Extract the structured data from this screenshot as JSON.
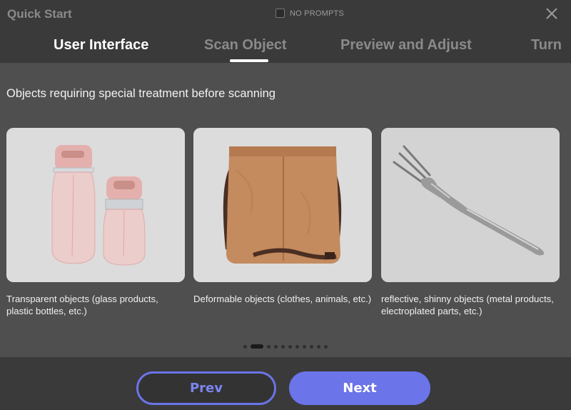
{
  "window": {
    "title": "Quick Start",
    "no_prompts_label": "NO PROMPTS",
    "no_prompts_checked": false,
    "close_icon": "close-icon"
  },
  "tabs": [
    {
      "label": "User Interface",
      "active": true
    },
    {
      "label": "Scan Object",
      "active": false
    },
    {
      "label": "Preview and Adjust",
      "active": false
    },
    {
      "label": "Turn",
      "active": false
    }
  ],
  "main": {
    "heading": "Objects requiring special treatment before scanning",
    "cards": [
      {
        "image": "transparent-bottles-image",
        "caption": "Transparent objects (glass products, plastic bottles, etc.)"
      },
      {
        "image": "leather-bag-image",
        "caption": "Deformable objects (clothes, animals, etc.)"
      },
      {
        "image": "metal-fork-image",
        "caption": "reflective, shinny objects (metal products, electroplated parts, etc.)"
      }
    ],
    "pagination": {
      "total": 11,
      "current": 2
    }
  },
  "footer": {
    "prev_label": "Prev",
    "next_label": "Next"
  },
  "colors": {
    "accent": "#6b74e8",
    "background_dark": "#3a3a3a",
    "background_content": "#4f4f4f"
  }
}
